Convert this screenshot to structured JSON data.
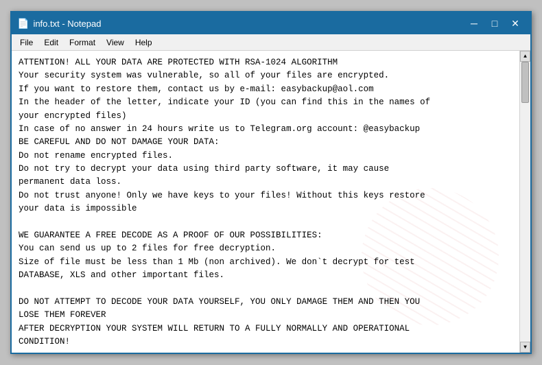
{
  "window": {
    "title": "info.txt - Notepad",
    "icon": "📄"
  },
  "menu": {
    "items": [
      "File",
      "Edit",
      "Format",
      "View",
      "Help"
    ]
  },
  "content": {
    "text": "ATTENTION! ALL YOUR DATA ARE PROTECTED WITH RSA-1024 ALGORITHM\nYour security system was vulnerable, so all of your files are encrypted.\nIf you want to restore them, contact us by e-mail: easybackup@aol.com\nIn the header of the letter, indicate your ID (you can find this in the names of\nyour encrypted files)\nIn case of no answer in 24 hours write us to Telegram.org account: @easybackup\nBE CAREFUL AND DO NOT DAMAGE YOUR DATA:\nDo not rename encrypted files.\nDo not try to decrypt your data using third party software, it may cause\npermanent data loss.\nDo not trust anyone! Only we have keys to your files! Without this keys restore\nyour data is impossible\n\nWE GUARANTEE A FREE DECODE AS A PROOF OF OUR POSSIBILITIES:\nYou can send us up to 2 files for free decryption.\nSize of file must be less than 1 Mb (non archived). We don`t decrypt for test\nDATABASE, XLS and other important files.\n\nDO NOT ATTEMPT TO DECODE YOUR DATA YOURSELF, YOU ONLY DAMAGE THEM AND THEN YOU\nLOSE THEM FOREVER\nAFTER DECRYPTION YOUR SYSTEM WILL RETURN TO A FULLY NORMALLY AND OPERATIONAL\nCONDITION!"
  },
  "titlebar": {
    "minimize_label": "─",
    "maximize_label": "□",
    "close_label": "✕"
  }
}
